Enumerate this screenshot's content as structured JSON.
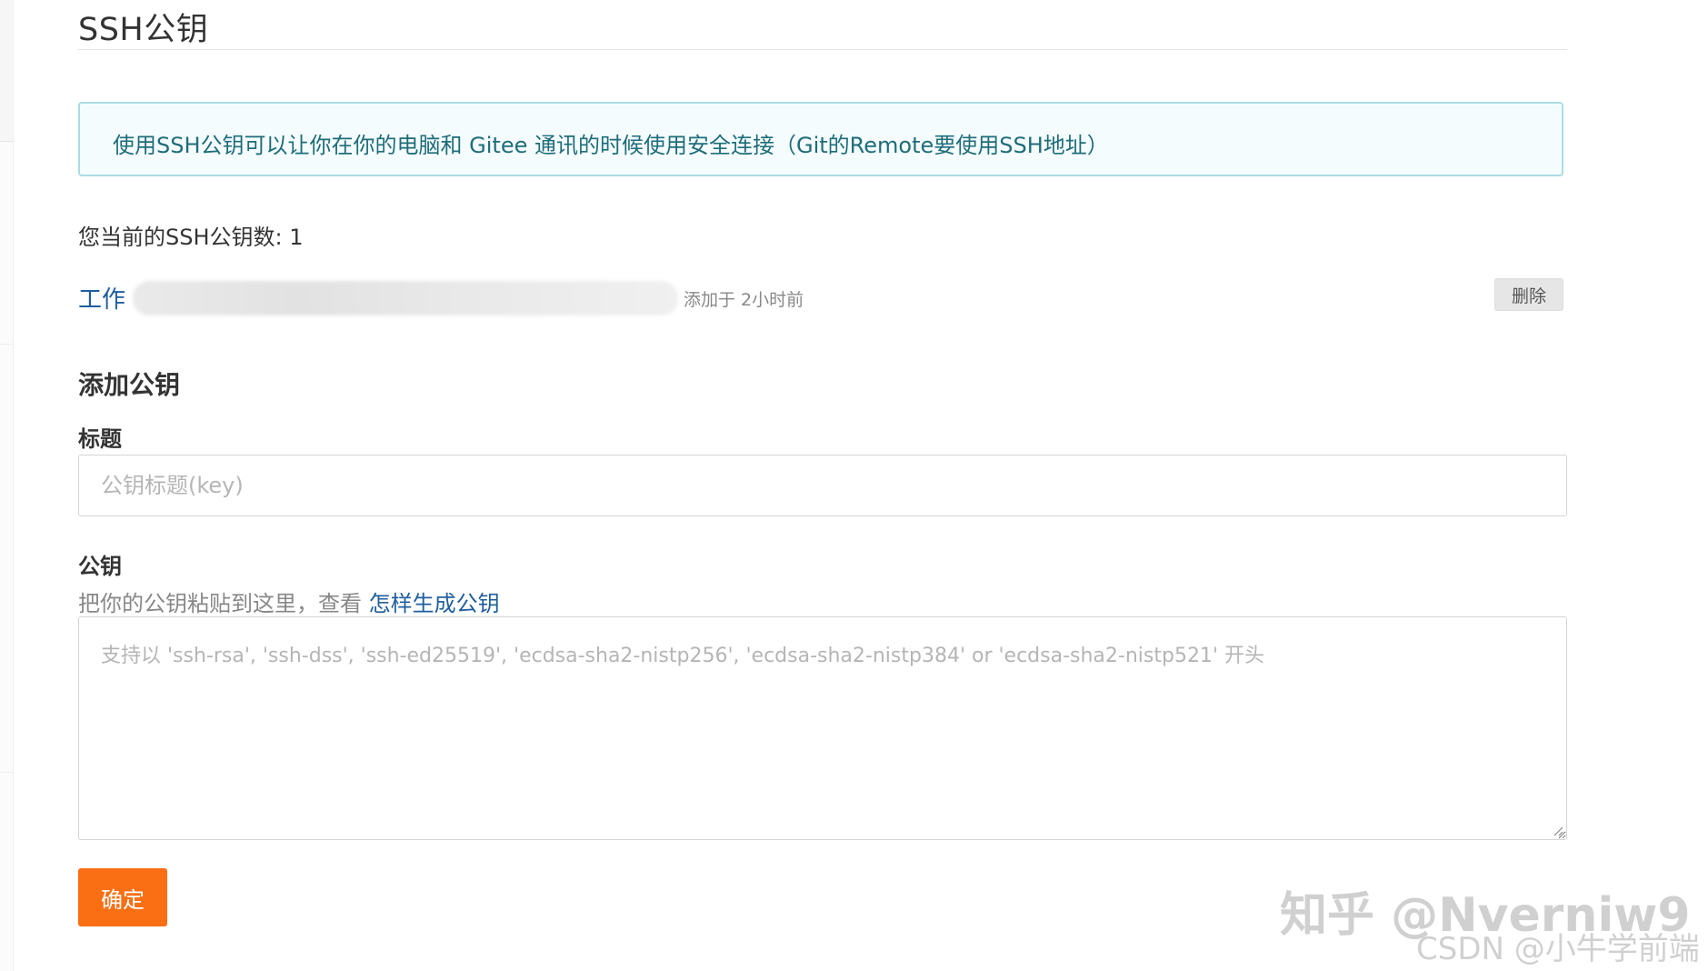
{
  "page": {
    "title": "SSH公钥"
  },
  "info": {
    "text": "使用SSH公钥可以让你在你的电脑和 Gitee 通讯的时候使用安全连接（Git的Remote要使用SSH地址）"
  },
  "keys": {
    "count_label": "您当前的SSH公钥数: 1",
    "items": [
      {
        "name": "工作",
        "added": "添加于 2小时前",
        "delete_label": "删除"
      }
    ]
  },
  "add_key": {
    "section_title": "添加公钥",
    "title_label": "标题",
    "title_placeholder": "公钥标题(key)",
    "key_label": "公钥",
    "hint_text": "把你的公钥粘贴到这里，查看 ",
    "hint_link": "怎样生成公钥",
    "key_placeholder": "支持以 'ssh-rsa', 'ssh-dss', 'ssh-ed25519', 'ecdsa-sha2-nistp256', 'ecdsa-sha2-nistp384' or 'ecdsa-sha2-nistp521' 开头",
    "confirm_label": "确定"
  },
  "watermarks": {
    "line1": "知乎 @Nverniw9",
    "line2": "CSDN @小牛学前端"
  },
  "colors": {
    "accent": "#fa6f14",
    "link": "#1f5e9e",
    "info_border": "#aadde3",
    "info_text": "#1e6d7a"
  }
}
